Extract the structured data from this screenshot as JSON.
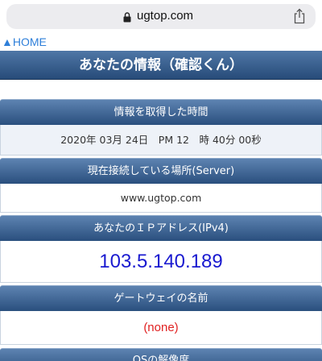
{
  "browser": {
    "url": "ugtop.com",
    "lock_icon": "lock-icon",
    "share_icon": "share-icon"
  },
  "nav": {
    "home_label": "▲HOME"
  },
  "page": {
    "title": "あなたの情報（確認くん）"
  },
  "sections": {
    "time": {
      "header": "情報を取得した時間",
      "value": "2020年 03月 24日　PM 12　時 40分 00秒"
    },
    "server": {
      "header": "現在接続している場所(Server)",
      "value": "www.ugtop.com"
    },
    "ip": {
      "header": "あなたのＩＰアドレス(IPv4)",
      "value": "103.5.140.189"
    },
    "gateway": {
      "header": "ゲートウェイの名前",
      "value": "(none)"
    },
    "os_resolution": {
      "header": "OSの解像度"
    }
  },
  "colors": {
    "header_gradient_top": "#5d83b1",
    "header_gradient_bottom": "#2a4f7e",
    "ip_color": "#1a1ad0",
    "gateway_color": "#e02020",
    "link_color": "#2e7fd9"
  }
}
